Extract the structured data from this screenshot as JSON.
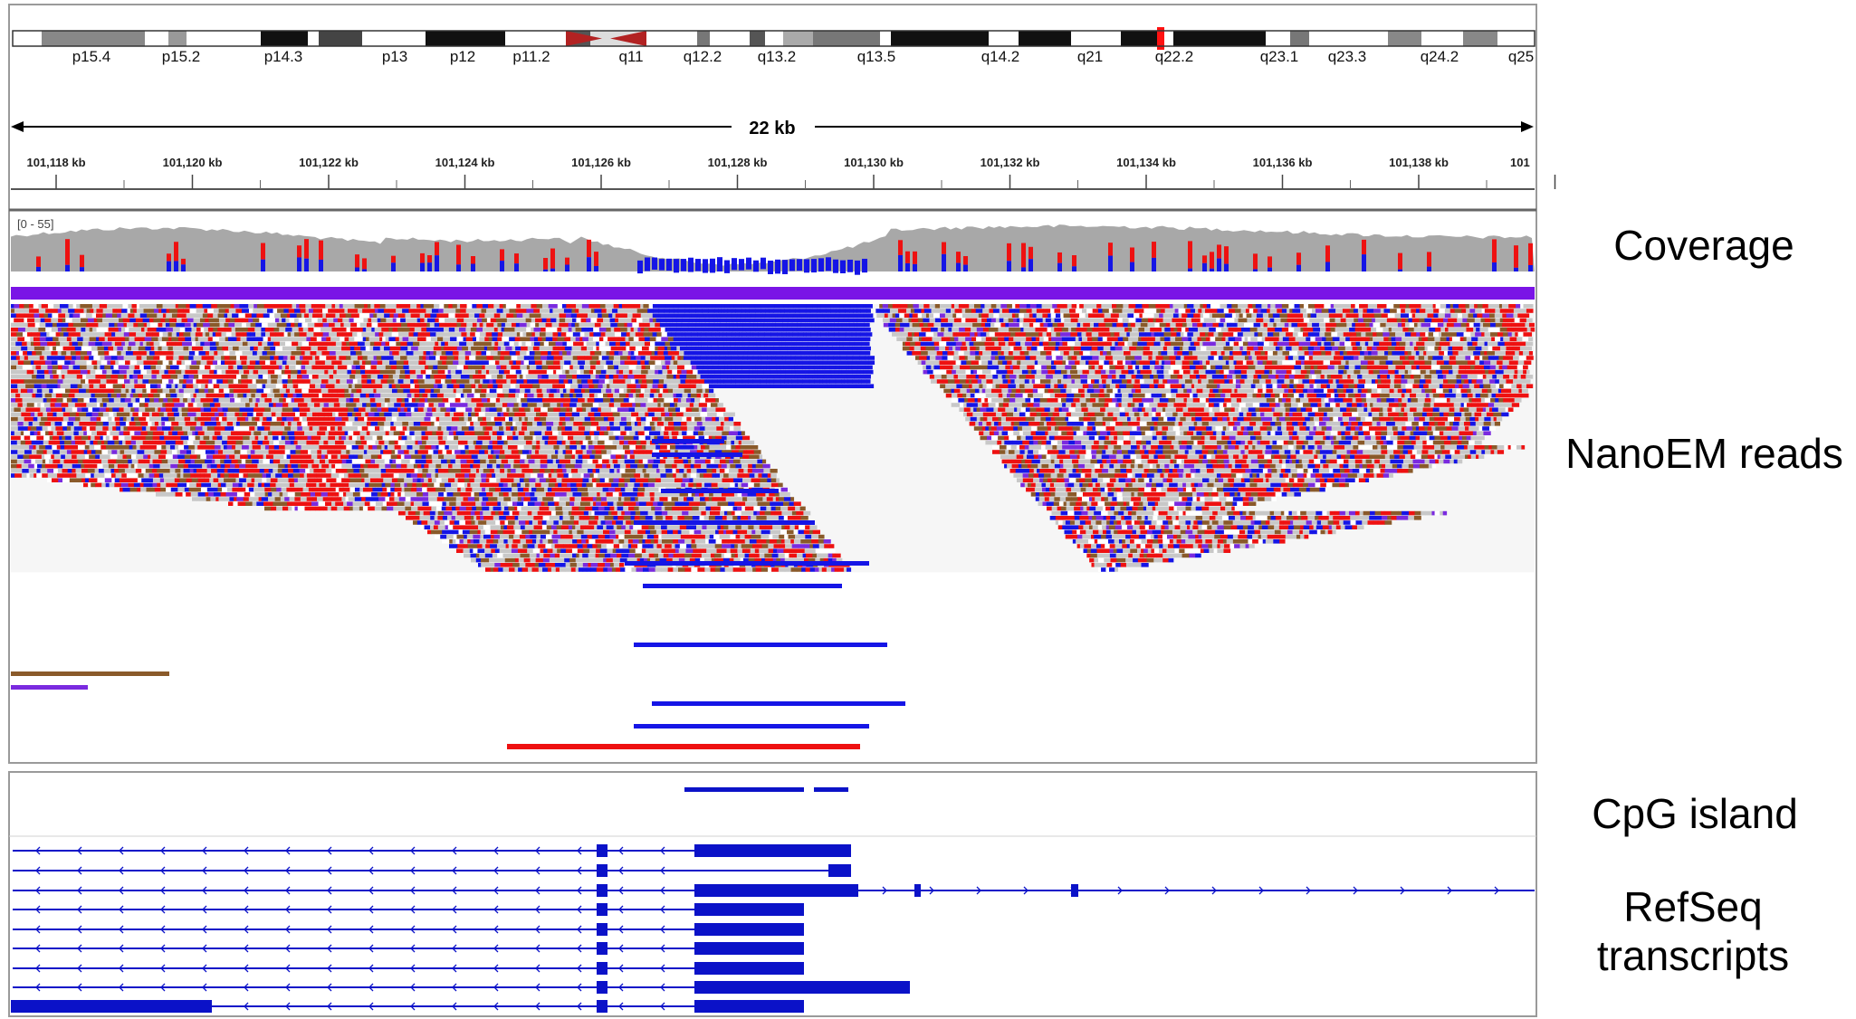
{
  "ideogram": {
    "bands": [
      "p15.4",
      "p15.2",
      "p14.3",
      "p13",
      "p12",
      "p11.2",
      "q11",
      "q12.2",
      "q13.2",
      "q13.5",
      "q14.2",
      "q21",
      "q22.2",
      "q23.1",
      "q23.3",
      "q24.2",
      "q25"
    ]
  },
  "ruler": {
    "span_label": "22 kb",
    "tick_labels": [
      "101,118 kb",
      "101,120 kb",
      "101,122 kb",
      "101,124 kb",
      "101,126 kb",
      "101,128 kb",
      "101,130 kb",
      "101,132 kb",
      "101,134 kb",
      "101,136 kb",
      "101,138 kb",
      "101"
    ]
  },
  "coverage": {
    "range_label": "[0 - 55]"
  },
  "labels": {
    "coverage": "Coverage",
    "reads": "NanoEM reads",
    "cpg": "CpG island",
    "refseq_line1": "RefSeq",
    "refseq_line2": "transcripts"
  },
  "colors": {
    "methylated": "#ee1111",
    "unmethylated": "#1515e6",
    "other": "#8a5a2a",
    "purple": "#7a2adf",
    "gray": "#c8c8c8",
    "coverage_gray": "#a8a8a8",
    "feature_blue": "#0b12c8"
  }
}
